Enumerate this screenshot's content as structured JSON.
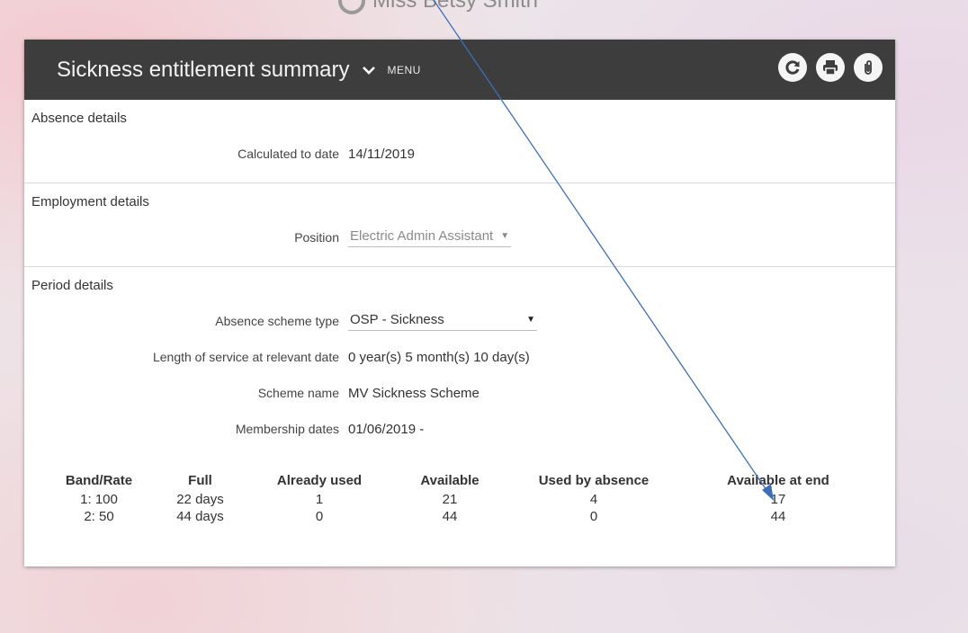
{
  "top_user": {
    "name": "Miss Betsy Smith"
  },
  "header": {
    "title": "Sickness entitlement summary",
    "menu_label": "MENU"
  },
  "absence": {
    "heading": "Absence details",
    "calc_label": "Calculated to date",
    "calc_value": "14/11/2019"
  },
  "employment": {
    "heading": "Employment details",
    "position_label": "Position",
    "position_value": "Electric Admin Assistant"
  },
  "period": {
    "heading": "Period details",
    "scheme_type_label": "Absence scheme type",
    "scheme_type_value": "OSP - Sickness",
    "service_label": "Length of service at relevant date",
    "service_value": "0 year(s) 5 month(s) 10 day(s)",
    "scheme_name_label": "Scheme name",
    "scheme_name_value": "MV Sickness Scheme",
    "membership_label": "Membership dates",
    "membership_value": "01/06/2019 -"
  },
  "bands": {
    "headers": [
      "Band/Rate",
      "Full",
      "Already used",
      "Available",
      "Used by absence",
      "Available at end"
    ],
    "rows": [
      [
        "1: 100",
        "22 days",
        "1",
        "21",
        "4",
        "17"
      ],
      [
        "2: 50",
        "44 days",
        "0",
        "44",
        "0",
        "44"
      ]
    ]
  },
  "colors": {
    "titlebar": "#3d3d3d",
    "annotation_arrow": "#3d6fb4"
  },
  "icons": [
    "chevron-down-icon",
    "refresh-icon",
    "print-icon",
    "attachment-icon"
  ]
}
